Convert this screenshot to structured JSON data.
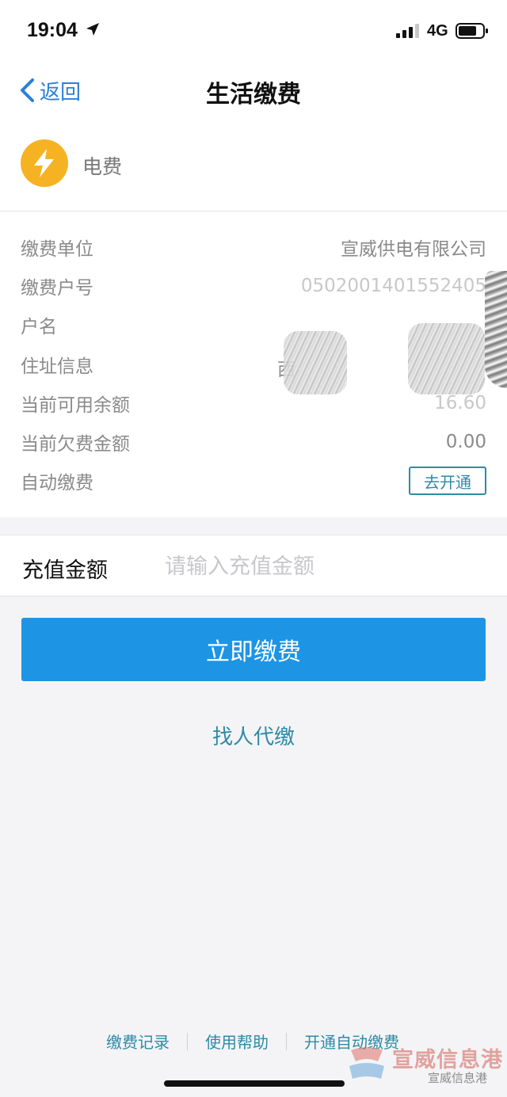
{
  "status_bar": {
    "time": "19:04",
    "network": "4G"
  },
  "nav": {
    "back_label": "返回",
    "title": "生活缴费",
    "accent_color": "#2b7fd6"
  },
  "bill": {
    "icon": "lightning-icon",
    "type": "电费",
    "rows": [
      {
        "label": "缴费单位",
        "value": "宣威供电有限公司"
      },
      {
        "label": "缴费户号",
        "value": "0502001401552405"
      },
      {
        "label": "户名",
        "value": ""
      },
      {
        "label": "住址信息",
        "value": "西"
      },
      {
        "label": "当前可用余额",
        "value": "16.60"
      },
      {
        "label": "当前欠费金额",
        "value": "0.00"
      },
      {
        "label": "自动缴费",
        "action_label": "去开通"
      }
    ]
  },
  "recharge": {
    "label": "充值金额",
    "placeholder": "请输入充值金额",
    "value": ""
  },
  "actions": {
    "pay_label": "立即缴费",
    "pay_color": "#1e94e4",
    "proxy_label": "找人代缴"
  },
  "footer": {
    "links": [
      "缴费记录",
      "使用帮助",
      "开通自动缴费"
    ]
  },
  "watermark": {
    "title": "宣威信息港",
    "subtitle": "宣威信息港"
  }
}
